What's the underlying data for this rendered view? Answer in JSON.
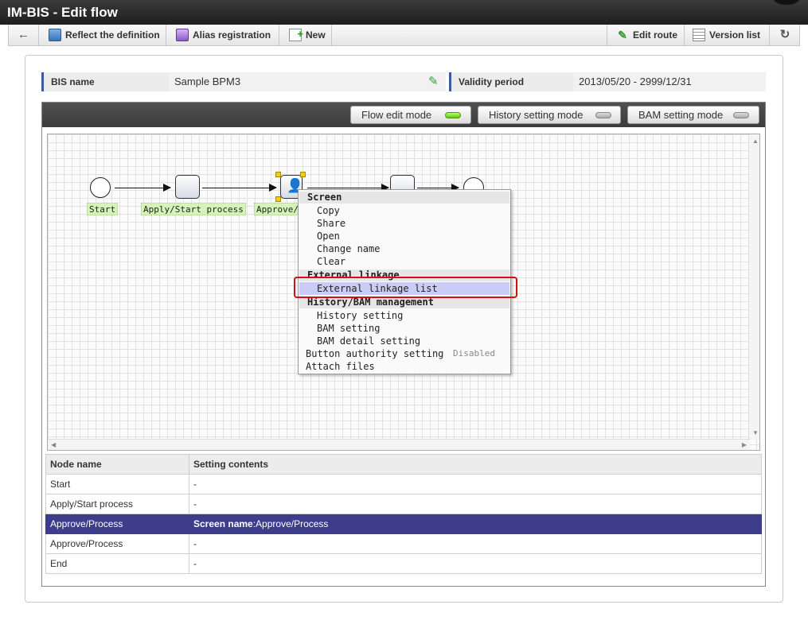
{
  "window": {
    "title": "IM-BIS - Edit flow"
  },
  "toolbar": {
    "back_icon": "arrow-left-icon",
    "reflect_label": "Reflect the definition",
    "alias_label": "Alias registration",
    "new_label": "New",
    "edit_route_label": "Edit route",
    "version_list_label": "Version list",
    "refresh_icon": "refresh-icon"
  },
  "info": {
    "bis_name_label": "BIS name",
    "bis_name_value": "Sample BPM3",
    "validity_label": "Validity period",
    "validity_value": "2013/05/20 - 2999/12/31"
  },
  "modes": {
    "flow_edit": "Flow edit mode",
    "history_setting": "History setting mode",
    "bam_setting": "BAM setting mode",
    "active": "flow_edit"
  },
  "flow": {
    "labels": {
      "start": "Start",
      "apply": "Apply/Start process",
      "approve": "Approve/P"
    }
  },
  "context_menu": {
    "screen_header": "Screen",
    "screen_items": [
      "Copy",
      "Share",
      "Open",
      "Change name",
      "Clear"
    ],
    "external_header": "External linkage",
    "external_items": [
      "External linkage list"
    ],
    "history_header": "History/BAM management",
    "history_items": [
      "History setting",
      "BAM setting",
      "BAM detail setting"
    ],
    "button_authority": "Button authority setting",
    "button_authority_state": "Disabled",
    "attach_files": "Attach files"
  },
  "table": {
    "headers": [
      "Node name",
      "Setting contents"
    ],
    "rows": [
      {
        "node": "Start",
        "setting": "-"
      },
      {
        "node": "Apply/Start process",
        "setting": "-"
      },
      {
        "node": "Approve/Process",
        "setting_label": "Screen name",
        "setting_value": ":Approve/Process",
        "selected": true
      },
      {
        "node": "Approve/Process",
        "setting": "-"
      },
      {
        "node": "End",
        "setting": "-"
      }
    ]
  },
  "colors": {
    "selected_row": "#3d3d8c",
    "highlight_border": "#d21010",
    "active_led": "#5ec814"
  }
}
